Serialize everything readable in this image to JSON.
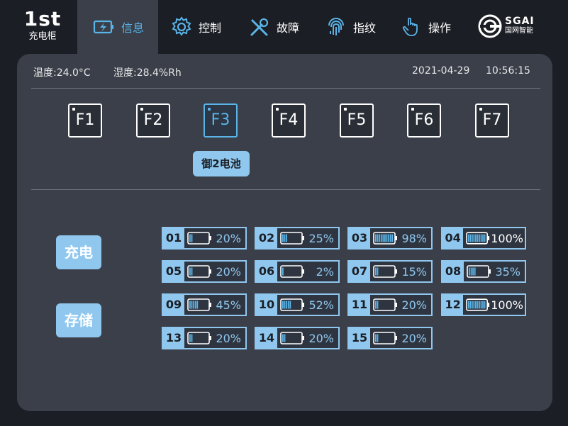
{
  "brand": {
    "num": "1st",
    "sub": "充电柜"
  },
  "nav": [
    {
      "label": "信息",
      "icon": "battery-charge-icon",
      "active": true
    },
    {
      "label": "控制",
      "icon": "gear-icon",
      "active": false
    },
    {
      "label": "故障",
      "icon": "tools-icon",
      "active": false
    },
    {
      "label": "指纹",
      "icon": "fingerprint-icon",
      "active": false
    },
    {
      "label": "操作",
      "icon": "hand-pointer-icon",
      "active": false
    }
  ],
  "logo": {
    "name": "SGAI",
    "sub": "国网智能"
  },
  "status": {
    "temperature": "温度:24.0°C",
    "humidity": "湿度:28.4%Rh",
    "date": "2021-04-29",
    "time": "10:56:15"
  },
  "floors": [
    "F1",
    "F2",
    "F3",
    "F4",
    "F5",
    "F6",
    "F7"
  ],
  "selected_floor": "F3",
  "floor_label": "御2电池",
  "side_buttons": {
    "charge": "充电",
    "storage": "存储"
  },
  "colors": {
    "accent": "#5ab4e8",
    "light_accent": "#8fc7ef",
    "panel": "#3a3f49",
    "background": "#1b1e24"
  },
  "batteries": [
    {
      "id": "01",
      "percent": "20%",
      "level": 0.2
    },
    {
      "id": "02",
      "percent": "25%",
      "level": 0.25
    },
    {
      "id": "03",
      "percent": "98%",
      "level": 0.98
    },
    {
      "id": "04",
      "percent": "100%",
      "level": 1.0
    },
    {
      "id": "05",
      "percent": "20%",
      "level": 0.2
    },
    {
      "id": "06",
      "percent": "2%",
      "level": 0.02
    },
    {
      "id": "07",
      "percent": "15%",
      "level": 0.15
    },
    {
      "id": "08",
      "percent": "35%",
      "level": 0.35
    },
    {
      "id": "09",
      "percent": "45%",
      "level": 0.45
    },
    {
      "id": "10",
      "percent": "52%",
      "level": 0.52
    },
    {
      "id": "11",
      "percent": "20%",
      "level": 0.2
    },
    {
      "id": "12",
      "percent": "100%",
      "level": 1.0
    },
    {
      "id": "13",
      "percent": "20%",
      "level": 0.2
    },
    {
      "id": "14",
      "percent": "20%",
      "level": 0.2
    },
    {
      "id": "15",
      "percent": "20%",
      "level": 0.2
    }
  ]
}
